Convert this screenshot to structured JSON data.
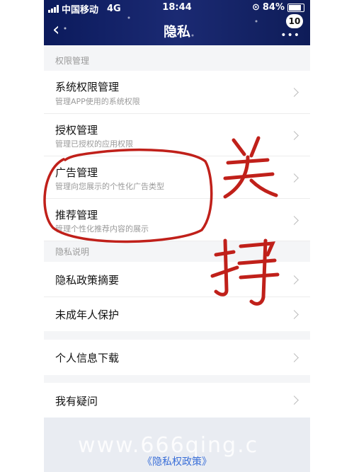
{
  "status_bar": {
    "carrier": "中国移动",
    "network": "4G",
    "time": "18:44",
    "battery": "84%",
    "battery_level": 0.84
  },
  "nav": {
    "back_icon": "chevron-left-icon",
    "title": "隐私",
    "badge": "10"
  },
  "sections": {
    "permissions": "权限管理",
    "privacy": "隐私说明"
  },
  "rows": {
    "system_permissions": {
      "title": "系统权限管理",
      "subtitle": "管理APP使用的系统权限"
    },
    "authorization": {
      "title": "授权管理",
      "subtitle": "管理已授权的应用权限"
    },
    "ads": {
      "title": "广告管理",
      "subtitle": "管理向您展示的个性化广告类型"
    },
    "recommend": {
      "title": "推荐管理",
      "subtitle": "管理个性化推荐内容的展示"
    },
    "policy_summary": {
      "title": "隐私政策摘要"
    },
    "minor_protection": {
      "title": "未成年人保护"
    },
    "info_download": {
      "title": "个人信息下载"
    },
    "questions": {
      "title": "我有疑问"
    }
  },
  "footer": {
    "link": "《隐私权政策》"
  },
  "annotation": {
    "text": "关掉",
    "color": "#c0201a"
  },
  "watermark": "www.666qing.c"
}
